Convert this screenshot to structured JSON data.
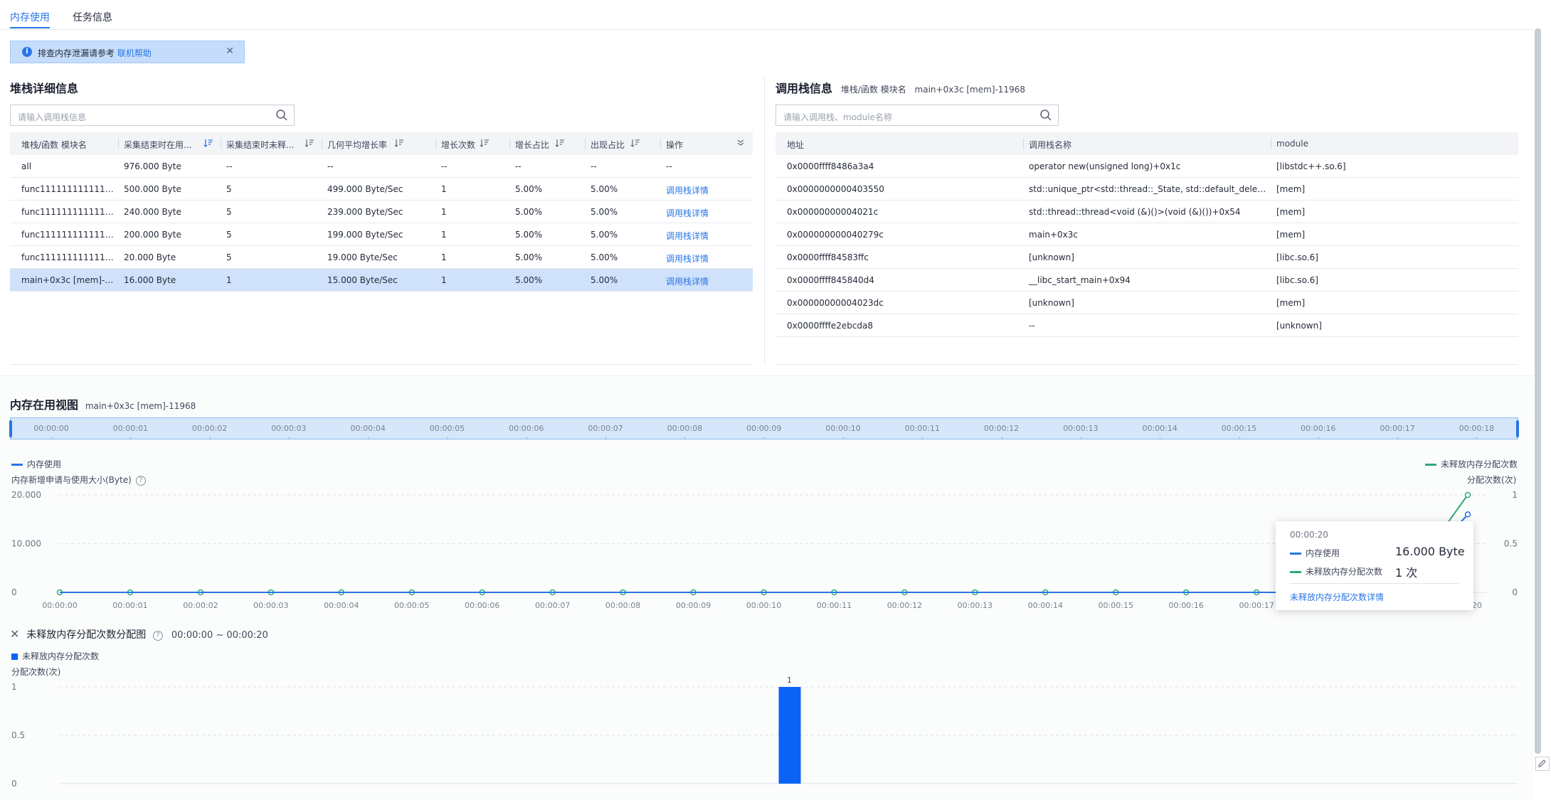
{
  "tabs": [
    {
      "label": "内存使用",
      "active": true
    },
    {
      "label": "任务信息",
      "active": false
    }
  ],
  "notice": {
    "text": "排查内存泄漏请参考",
    "link": "联机帮助"
  },
  "stack_detail": {
    "title": "堆栈详细信息",
    "search_placeholder": "请输入调用栈信息",
    "columns": [
      "堆栈/函数 模块名",
      "采集结束时在用...",
      "采集结束时未释...",
      "几何平均增长率",
      "增长次数",
      "增长占比",
      "出现占比",
      "操作"
    ],
    "rows": [
      {
        "name": "all",
        "in_use": "976.000 Byte",
        "unreleased": "--",
        "growth_rate": "--",
        "growth_count": "--",
        "growth_pct": "--",
        "occur_pct": "--",
        "action": "--"
      },
      {
        "name": "func1111111111111()+...",
        "in_use": "500.000 Byte",
        "unreleased": "5",
        "growth_rate": "499.000 Byte/Sec",
        "growth_count": "1",
        "growth_pct": "5.00%",
        "occur_pct": "5.00%",
        "action": "调用栈详情"
      },
      {
        "name": "func1111111111111()+...",
        "in_use": "240.000 Byte",
        "unreleased": "5",
        "growth_rate": "239.000 Byte/Sec",
        "growth_count": "1",
        "growth_pct": "5.00%",
        "occur_pct": "5.00%",
        "action": "调用栈详情"
      },
      {
        "name": "func1111111111111()+...",
        "in_use": "200.000 Byte",
        "unreleased": "5",
        "growth_rate": "199.000 Byte/Sec",
        "growth_count": "1",
        "growth_pct": "5.00%",
        "occur_pct": "5.00%",
        "action": "调用栈详情"
      },
      {
        "name": "func1111111111111()+...",
        "in_use": "20.000 Byte",
        "unreleased": "5",
        "growth_rate": "19.000 Byte/Sec",
        "growth_count": "1",
        "growth_pct": "5.00%",
        "occur_pct": "5.00%",
        "action": "调用栈详情"
      },
      {
        "name": "main+0x3c [mem]-11...",
        "in_use": "16.000 Byte",
        "unreleased": "1",
        "growth_rate": "15.000 Byte/Sec",
        "growth_count": "1",
        "growth_pct": "5.00%",
        "occur_pct": "5.00%",
        "action": "调用栈详情",
        "selected": true
      }
    ]
  },
  "call_stack": {
    "title": "调用栈信息",
    "meta_label": "堆栈/函数 模块名",
    "meta_value": "main+0x3c [mem]-11968",
    "search_placeholder": "请输入调用栈、module名称",
    "columns": [
      "地址",
      "调用栈名称",
      "module"
    ],
    "rows": [
      {
        "addr": "0x0000ffff8486a3a4",
        "name": "operator new(unsigned long)+0x1c",
        "module": "[libstdc++.so.6]"
      },
      {
        "addr": "0x0000000000403550",
        "name": "std::unique_ptr<std::thread::_State, std::default_delete<std::th...",
        "module": "[mem]"
      },
      {
        "addr": "0x00000000004021c",
        "name": "std::thread::thread<void (&)()>(void (&)())+0x54",
        "module": "[mem]"
      },
      {
        "addr": "0x000000000040279c",
        "name": "main+0x3c",
        "module": "[mem]"
      },
      {
        "addr": "0x0000ffff84583ffc",
        "name": "[unknown]",
        "module": "[libc.so.6]"
      },
      {
        "addr": "0x0000ffff845840d4",
        "name": "__libc_start_main+0x94",
        "module": "[libc.so.6]"
      },
      {
        "addr": "0x00000000004023dc",
        "name": "[unknown]",
        "module": "[mem]"
      },
      {
        "addr": "0x0000ffffe2ebcda8",
        "name": "--",
        "module": "[unknown]"
      }
    ]
  },
  "memory_view": {
    "title": "内存在用视图",
    "subtitle": "main+0x3c [mem]-11968",
    "timeline_ticks": [
      "00:00:00",
      "00:00:01",
      "00:00:02",
      "00:00:03",
      "00:00:04",
      "00:00:05",
      "00:00:06",
      "00:00:07",
      "00:00:08",
      "00:00:09",
      "00:00:10",
      "00:00:11",
      "00:00:12",
      "00:00:13",
      "00:00:14",
      "00:00:15",
      "00:00:16",
      "00:00:17",
      "00:00:18"
    ],
    "legend_left": "内存使用",
    "legend_right": "未释放内存分配次数",
    "ylabel_left": "内存新增申请与使用大小(Byte)",
    "ylabel_right": "分配次数(次)",
    "colors": {
      "memory": "#2a75e6",
      "alloc": "#2fa87a"
    }
  },
  "chart_data": [
    {
      "type": "line",
      "x": [
        "00:00:00",
        "00:00:01",
        "00:00:02",
        "00:00:03",
        "00:00:04",
        "00:00:05",
        "00:00:06",
        "00:00:07",
        "00:00:08",
        "00:00:09",
        "00:00:10",
        "00:00:11",
        "00:00:12",
        "00:00:13",
        "00:00:14",
        "00:00:15",
        "00:00:16",
        "00:00:17",
        "00:00:18",
        "00:00:19",
        "00:00:20"
      ],
      "x_tick_labels": [
        "00:00:00",
        "00:00:01",
        "00:00:02",
        "00:00:03",
        "00:00:04",
        "00:00:05",
        "00:00:06",
        "00:00:07",
        "00:00:08",
        "00:00:09",
        "00:00:10",
        "00:00:11",
        "00:00:12",
        "00:00:13",
        "00:00:14",
        "00:00:15",
        "00:00:16",
        "00:00:17",
        "00:00:18",
        "00:00:19",
        "00:00:20"
      ],
      "x_tick_last": "20",
      "series": [
        {
          "name": "内存使用",
          "axis": "left",
          "values": [
            0,
            0,
            0,
            0,
            0,
            0,
            0,
            0,
            0,
            0,
            0,
            0,
            0,
            0,
            0,
            0,
            0,
            0,
            0,
            0,
            16
          ]
        },
        {
          "name": "未释放内存分配次数",
          "axis": "right",
          "values": [
            0,
            0,
            0,
            0,
            0,
            0,
            0,
            0,
            0,
            0,
            0,
            0,
            0,
            0,
            0,
            0,
            0,
            0,
            0,
            0,
            1
          ]
        }
      ],
      "y_left_ticks": [
        "20.000",
        "10.000",
        "0"
      ],
      "ylim_left": [
        0,
        20
      ],
      "y_right_ticks": [
        "1",
        "0.5",
        "0"
      ],
      "ylim_right": [
        0,
        1
      ]
    },
    {
      "type": "bar",
      "title": "未释放内存分配次数分配图",
      "range": "00:00:00 ~ 00:00:20",
      "legend": "未释放内存分配次数",
      "ylabel": "分配次数(次)",
      "y_ticks": [
        "1",
        "0.5",
        "0"
      ],
      "ylim": [
        0,
        1
      ],
      "bars": [
        {
          "x": 10,
          "value": 1,
          "label": "1"
        }
      ],
      "x_domain": [
        0,
        20
      ]
    }
  ],
  "tooltip": {
    "time": "00:00:20",
    "rows": [
      {
        "label": "内存使用",
        "value": "16.000 Byte"
      },
      {
        "label": "未释放内存分配次数",
        "value": "1 次"
      }
    ],
    "link": "未释放内存分配次数详情"
  }
}
